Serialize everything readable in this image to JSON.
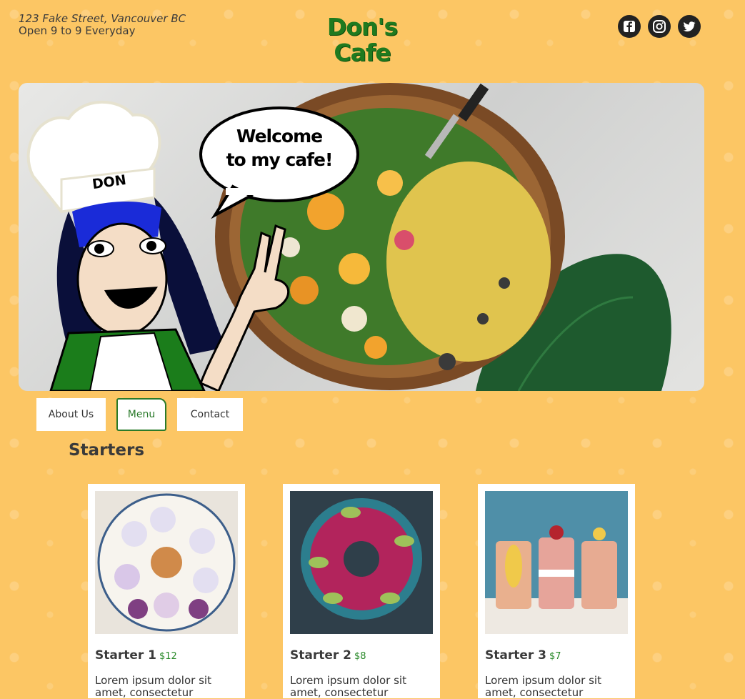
{
  "header": {
    "address": "123 Fake Street, Vancouver BC",
    "hours": "Open 9 to 9 Everyday",
    "logo_line1": "Don's",
    "logo_line2": "Cafe",
    "socials": [
      {
        "name": "facebook",
        "icon": "facebook-icon"
      },
      {
        "name": "instagram",
        "icon": "instagram-icon"
      },
      {
        "name": "twitter",
        "icon": "twitter-icon"
      }
    ]
  },
  "hero": {
    "speech": "Welcome to my cafe!",
    "chef_hat_text": "DON"
  },
  "nav": {
    "items": [
      {
        "label": "About Us",
        "active": false
      },
      {
        "label": "Menu",
        "active": true
      },
      {
        "label": "Contact",
        "active": false
      }
    ]
  },
  "section": {
    "title": "Starters"
  },
  "cards": [
    {
      "title": "Starter 1",
      "price": "$12",
      "desc": "Lorem ipsum dolor sit amet, consectetur"
    },
    {
      "title": "Starter 2",
      "price": "$8",
      "desc": "Lorem ipsum dolor sit amet, consectetur"
    },
    {
      "title": "Starter 3",
      "price": "$7",
      "desc": "Lorem ipsum dolor sit amet, consectetur"
    }
  ],
  "colors": {
    "background": "#fcc664",
    "accent_green": "#2a7a2a",
    "text": "#3a3a3a"
  }
}
